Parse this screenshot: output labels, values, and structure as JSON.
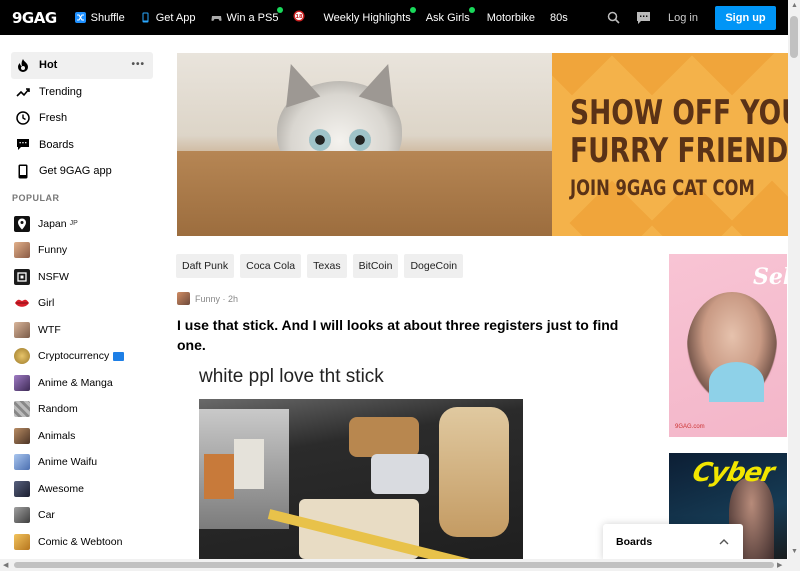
{
  "header": {
    "logo": "9GAG",
    "nav": [
      {
        "label": "Shuffle",
        "icon": "shuffle-icon",
        "color": "#1e90ff",
        "dot": false
      },
      {
        "label": "Get App",
        "icon": "phone-icon",
        "color": "#2aa8ff",
        "dot": false
      },
      {
        "label": "Win a PS5",
        "icon": "gamepad-icon",
        "color": "#aaaaaa",
        "dot": true
      },
      {
        "label": "",
        "icon": "18-plus-icon",
        "color": "#cc2222",
        "dot": false
      },
      {
        "label": "Weekly Highlights",
        "icon": "",
        "color": "",
        "dot": true
      },
      {
        "label": "Ask Girls",
        "icon": "",
        "color": "",
        "dot": true
      },
      {
        "label": "Motorbike",
        "icon": "",
        "color": "",
        "dot": false
      },
      {
        "label": "80s",
        "icon": "",
        "color": "",
        "dot": false
      }
    ],
    "login": "Log in",
    "signup": "Sign up"
  },
  "sidebar": {
    "items": [
      {
        "label": "Hot",
        "icon": "flame-icon",
        "active": true
      },
      {
        "label": "Trending",
        "icon": "trending-icon",
        "active": false
      },
      {
        "label": "Fresh",
        "icon": "clock-icon",
        "active": false
      },
      {
        "label": "Boards",
        "icon": "chat-icon",
        "active": false
      },
      {
        "label": "Get 9GAG app",
        "icon": "phone-icon",
        "active": false
      }
    ],
    "popular_label": "POPULAR",
    "popular": [
      {
        "label": "Japan",
        "suffix": "JP",
        "thumb": "#111111"
      },
      {
        "label": "Funny",
        "suffix": "",
        "thumb": "#c98f6a"
      },
      {
        "label": "NSFW",
        "suffix": "",
        "thumb": "#1b1b1b"
      },
      {
        "label": "Girl",
        "suffix": "",
        "thumb": "#d81f2a"
      },
      {
        "label": "WTF",
        "suffix": "",
        "thumb": "#b3866a"
      },
      {
        "label": "Cryptocurrency",
        "suffix": "",
        "thumb": "#c4a04e",
        "badge": true
      },
      {
        "label": "Anime & Manga",
        "suffix": "",
        "thumb": "#6b4c8a"
      },
      {
        "label": "Random",
        "suffix": "",
        "thumb": "#9a9a9a"
      },
      {
        "label": "Animals",
        "suffix": "",
        "thumb": "#8b6b4b"
      },
      {
        "label": "Anime Waifu",
        "suffix": "",
        "thumb": "#5a7fbf"
      },
      {
        "label": "Awesome",
        "suffix": "",
        "thumb": "#2e3550"
      },
      {
        "label": "Car",
        "suffix": "",
        "thumb": "#6c6c6c"
      },
      {
        "label": "Comic & Webtoon",
        "suffix": "",
        "thumb": "#d9a23a"
      }
    ]
  },
  "banner": {
    "lines": [
      "SHOW OFF YOUR",
      "FURRY FRIENDS",
      "JOIN 9GAG CAT COM"
    ],
    "bg": "#f4b24a",
    "text_color": "#5a3217"
  },
  "tags": [
    "Daft Punk",
    "Coca Cola",
    "Texas",
    "BitCoin",
    "DogeCoin"
  ],
  "post": {
    "section": "Funny",
    "time": "2h",
    "title": "I use that stick. And I will looks at about three registers just to find one.",
    "caption": "white ppl love tht stick"
  },
  "ads": {
    "ad1_text": "Sel",
    "ad1_footer": "9GAG.com",
    "ad2_text": "Cyber"
  },
  "boards_popup": {
    "label": "Boards"
  }
}
